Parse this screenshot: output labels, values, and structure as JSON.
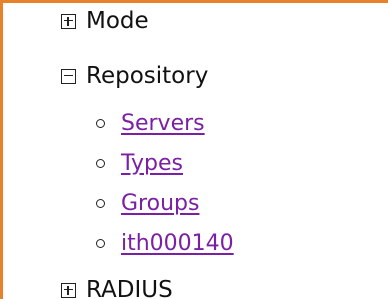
{
  "tree": {
    "mode": {
      "label": "Mode",
      "state": "collapsed"
    },
    "repository": {
      "label": "Repository",
      "state": "expanded",
      "children": [
        {
          "label": "Servers"
        },
        {
          "label": "Types"
        },
        {
          "label": "Groups"
        },
        {
          "label": "ith000140"
        }
      ]
    },
    "radius": {
      "label": "RADIUS",
      "state": "collapsed"
    }
  },
  "colors": {
    "frame_accent": "#e8822a",
    "link": "#7a1fa6",
    "text": "#111111"
  },
  "icons": {
    "collapsed": "plus-box-icon",
    "expanded": "minus-box-icon",
    "child": "hollow-circle-bullet-icon"
  }
}
